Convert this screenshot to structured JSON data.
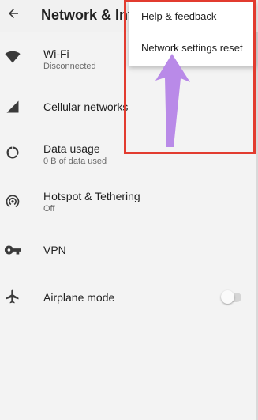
{
  "header": {
    "title": "Network & Internet",
    "back_icon": "arrow-back-icon"
  },
  "settings": {
    "items": [
      {
        "title": "Wi-Fi",
        "subtitle": "Disconnected",
        "icon": "wifi-icon"
      },
      {
        "title": "Cellular networks",
        "subtitle": "",
        "icon": "signal-icon"
      },
      {
        "title": "Data usage",
        "subtitle": "0 B of data used",
        "icon": "data-usage-icon"
      },
      {
        "title": "Hotspot & Tethering",
        "subtitle": "Off",
        "icon": "hotspot-icon"
      },
      {
        "title": "VPN",
        "subtitle": "",
        "icon": "vpn-key-icon"
      },
      {
        "title": "Airplane mode",
        "subtitle": "",
        "icon": "airplane-icon"
      }
    ]
  },
  "overflow_menu": {
    "items": [
      {
        "label": "Help & feedback"
      },
      {
        "label": "Network settings reset"
      }
    ]
  },
  "annotation": {
    "highlight_color": "#e23b2f",
    "arrow_color": "#b98ae8"
  }
}
